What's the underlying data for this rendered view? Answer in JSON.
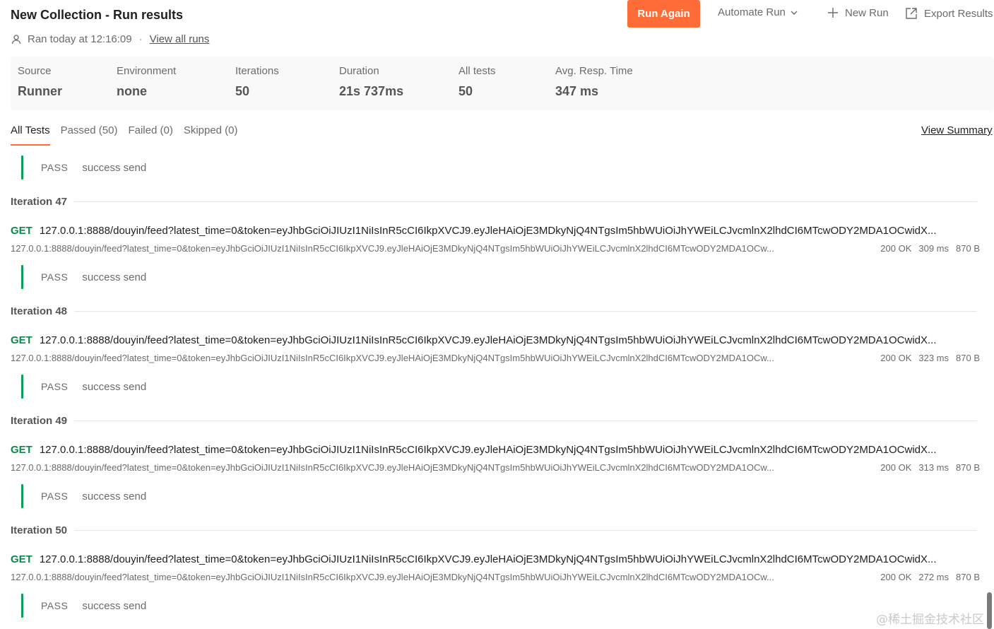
{
  "header": {
    "title": "New Collection - Run results",
    "ran_text": "Ran today at 12:16:09",
    "separator": "·",
    "view_all_runs": "View all runs",
    "run_again": "Run Again",
    "automate_run": "Automate Run",
    "new_run": "New Run",
    "export_results": "Export Results"
  },
  "colors": {
    "accent": "#ff6c37",
    "pass": "#0c9d57",
    "method_get": "#0a8a4a"
  },
  "summary": {
    "source": {
      "label": "Source",
      "value": "Runner"
    },
    "environment": {
      "label": "Environment",
      "value": "none"
    },
    "iterations": {
      "label": "Iterations",
      "value": "50"
    },
    "duration": {
      "label": "Duration",
      "value": "21s 737ms"
    },
    "all_tests": {
      "label": "All tests",
      "value": "50"
    },
    "avg_resp": {
      "label": "Avg. Resp. Time",
      "value": "347 ms"
    }
  },
  "tabs": {
    "all": "All Tests",
    "passed": "Passed (50)",
    "failed": "Failed (0)",
    "skipped": "Skipped (0)",
    "view_summary": "View Summary"
  },
  "results": {
    "pass_label": "PASS",
    "test_name": "success send",
    "method": "GET",
    "url_full": "127.0.0.1:8888/douyin/feed?latest_time=0&token=eyJhbGciOiJIUzI1NiIsInR5cCI6IkpXVCJ9.eyJleHAiOjE3MDkyNjQ4NTgsIm5hbWUiOiJhYWEiLCJvcmlnX2lhdCI6MTcwODY2MDA1OCwidX...",
    "url_sub": "127.0.0.1:8888/douyin/feed?latest_time=0&token=eyJhbGciOiJIUzI1NiIsInR5cCI6IkpXVCJ9.eyJleHAiOjE3MDkyNjQ4NTgsIm5hbWUiOiJhYWEiLCJvcmlnX2lhdCI6MTcwODY2MDA1OCw...",
    "iterations": [
      {
        "label": "Iteration 47",
        "status": "200 OK",
        "time": "309 ms",
        "size": "870 B"
      },
      {
        "label": "Iteration 48",
        "status": "200 OK",
        "time": "323 ms",
        "size": "870 B"
      },
      {
        "label": "Iteration 49",
        "status": "200 OK",
        "time": "313 ms",
        "size": "870 B"
      },
      {
        "label": "Iteration 50",
        "status": "200 OK",
        "time": "272 ms",
        "size": "870 B"
      }
    ]
  },
  "watermark": "@稀土掘金技术社区"
}
